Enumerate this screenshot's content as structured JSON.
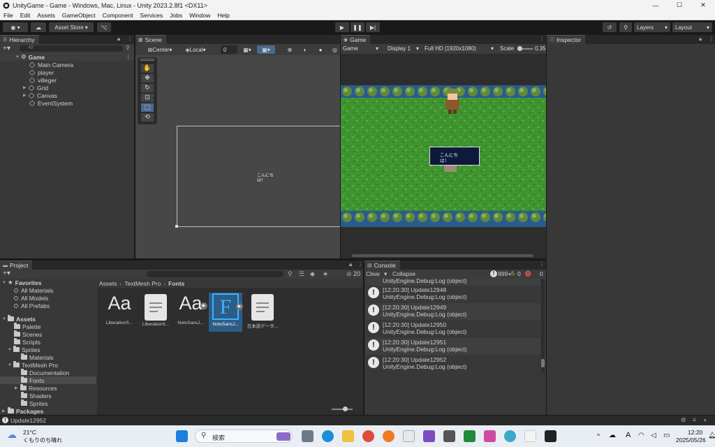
{
  "window": {
    "title": "UnityGame - Game - Windows, Mac, Linux - Unity 2023.2.8f1 <DX11>",
    "minimize": "—",
    "maximize": "☐",
    "close": "✕"
  },
  "menu": [
    "File",
    "Edit",
    "Assets",
    "GameObject",
    "Component",
    "Services",
    "Jobs",
    "Window",
    "Help"
  ],
  "toolbar": {
    "account": "◉ ▾",
    "asset_store": "Asset Store ▾",
    "layers": "Layers",
    "layout": "Layout"
  },
  "hierarchy": {
    "tab": "Hierarchy",
    "search_placeholder": "All",
    "root": "Game",
    "items": [
      "Main Camera",
      "player",
      "villeger",
      "Grid",
      "Canvas",
      "EventSystem"
    ]
  },
  "scene": {
    "tab": "Scene",
    "pivot": "Center",
    "space": "Local",
    "snap": "0",
    "dialog_text": "こんにち\nは！"
  },
  "game": {
    "tab": "Game",
    "mode": "Game",
    "display": "Display 1",
    "resolution": "Full HD (1920x1080)",
    "scale_label": "Scale",
    "scale_value": "0.35",
    "dialog_text": "こんにち\nは！"
  },
  "inspector": {
    "tab": "Inspector"
  },
  "project": {
    "tab": "Project",
    "tree": {
      "favorites": "Favorites",
      "fav_items": [
        "All Materials",
        "All Models",
        "All Prefabs"
      ],
      "assets": "Assets",
      "asset_items": [
        "Palette",
        "Scenes",
        "Scripts",
        "Sprites",
        "Materials",
        "TextMesh Pro",
        "Documentation",
        "Fonts",
        "Resources",
        "Shaders",
        "Sprites"
      ],
      "packages": "Packages"
    },
    "breadcrumb": [
      "Assets",
      "TextMesh Pro",
      "Fonts"
    ],
    "hidden_count": "20",
    "files": [
      {
        "label": "LiberationS...",
        "icon": "Aa"
      },
      {
        "label": "LiberationS...",
        "icon": "doc"
      },
      {
        "label": "NotoSansJ...",
        "icon": "Aa"
      },
      {
        "label": "NotoSansJ...",
        "icon": "F"
      },
      {
        "label": "日本語データ...",
        "icon": "doc"
      }
    ]
  },
  "console": {
    "tab": "Console",
    "clear": "Clear",
    "collapse": "Collapse",
    "log_count": "999+",
    "warn_count": "0",
    "error_count": "0",
    "partial_top": "UnityEngine.Debug:Log (object)",
    "entries": [
      {
        "line1": "[12:20:30] Update12948",
        "line2": "UnityEngine.Debug:Log (object)"
      },
      {
        "line1": "[12:20:30] Update12949",
        "line2": "UnityEngine.Debug:Log (object)"
      },
      {
        "line1": "[12:20:30] Update12950",
        "line2": "UnityEngine.Debug:Log (object)"
      },
      {
        "line1": "[12:20:30] Update12951",
        "line2": "UnityEngine.Debug:Log (object)"
      },
      {
        "line1": "[12:20:30] Update12952",
        "line2": "UnityEngine.Debug:Log (object)"
      }
    ]
  },
  "status_bar": {
    "message": "Update12952"
  },
  "taskbar": {
    "weather_temp": "21°C",
    "weather_desc": "くもりのち晴れ",
    "search": "検索",
    "time": "12:20",
    "date": "2025/05/26",
    "ime": "A"
  }
}
